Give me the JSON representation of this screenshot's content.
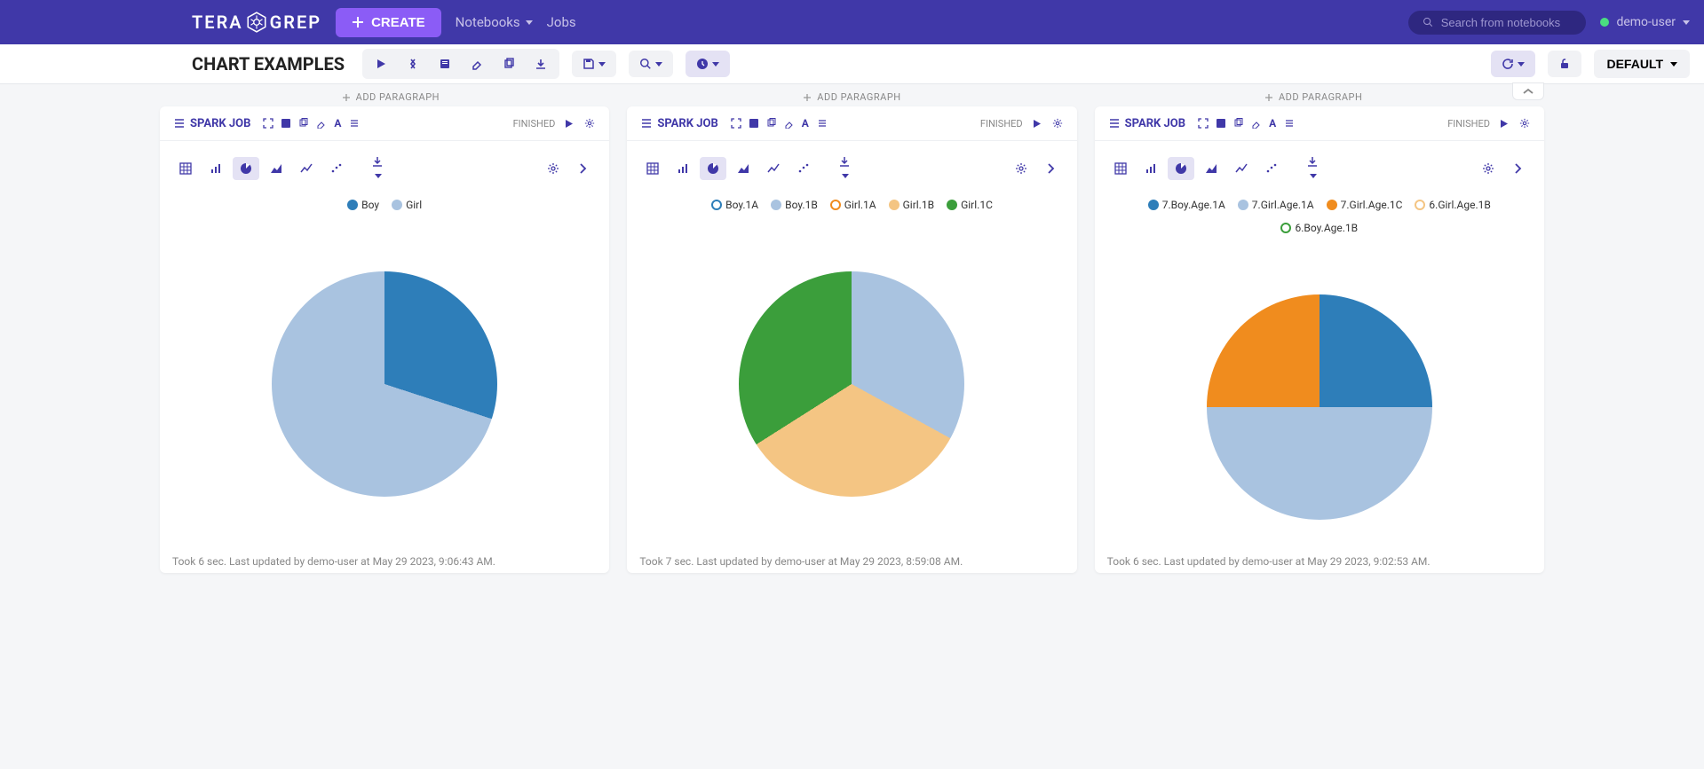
{
  "brand": {
    "left": "TERA",
    "right": "GREP"
  },
  "create_label": "CREATE",
  "nav": {
    "notebooks": "Notebooks",
    "jobs": "Jobs"
  },
  "search": {
    "placeholder": "Search from notebooks"
  },
  "user": "demo-user",
  "page_title": "CHART EXAMPLES",
  "default_label": "DEFAULT",
  "add_paragraph": "ADD PARAGRAPH",
  "spark_label": "SPARK JOB",
  "status_label": "FINISHED",
  "panels": [
    {
      "footer": "Took 6 sec. Last updated by demo-user at May 29 2023, 9:06:43 AM."
    },
    {
      "footer": "Took 7 sec. Last updated by demo-user at May 29 2023, 8:59:08 AM."
    },
    {
      "footer": "Took 6 sec. Last updated by demo-user at May 29 2023, 9:02:53 AM."
    }
  ],
  "chart_data": [
    {
      "type": "pie",
      "title": "",
      "series": [
        {
          "name": "Boy",
          "value": 30,
          "color": "#2e7eb9"
        },
        {
          "name": "Girl",
          "value": 70,
          "color": "#a9c3e0"
        }
      ]
    },
    {
      "type": "pie",
      "title": "",
      "series": [
        {
          "name": "Boy.1A",
          "value": 0,
          "color": "#2e7eb9",
          "ring": true
        },
        {
          "name": "Boy.1B",
          "value": 33,
          "color": "#a9c3e0"
        },
        {
          "name": "Girl.1A",
          "value": 0,
          "color": "#f08c1e",
          "ring": true
        },
        {
          "name": "Girl.1B",
          "value": 33,
          "color": "#f4c583"
        },
        {
          "name": "Girl.1C",
          "value": 34,
          "color": "#3b9e3b"
        }
      ]
    },
    {
      "type": "pie",
      "title": "",
      "series": [
        {
          "name": "7.Boy.Age.1A",
          "value": 25,
          "color": "#2e7eb9"
        },
        {
          "name": "7.Girl.Age.1A",
          "value": 50,
          "color": "#a9c3e0"
        },
        {
          "name": "7.Girl.Age.1C",
          "value": 25,
          "color": "#f08c1e"
        },
        {
          "name": "6.Girl.Age.1B",
          "value": 0,
          "color": "#f4c583",
          "ring": true
        },
        {
          "name": "6.Boy.Age.1B",
          "value": 0,
          "color": "#3b9e3b",
          "ring": true
        }
      ]
    }
  ]
}
